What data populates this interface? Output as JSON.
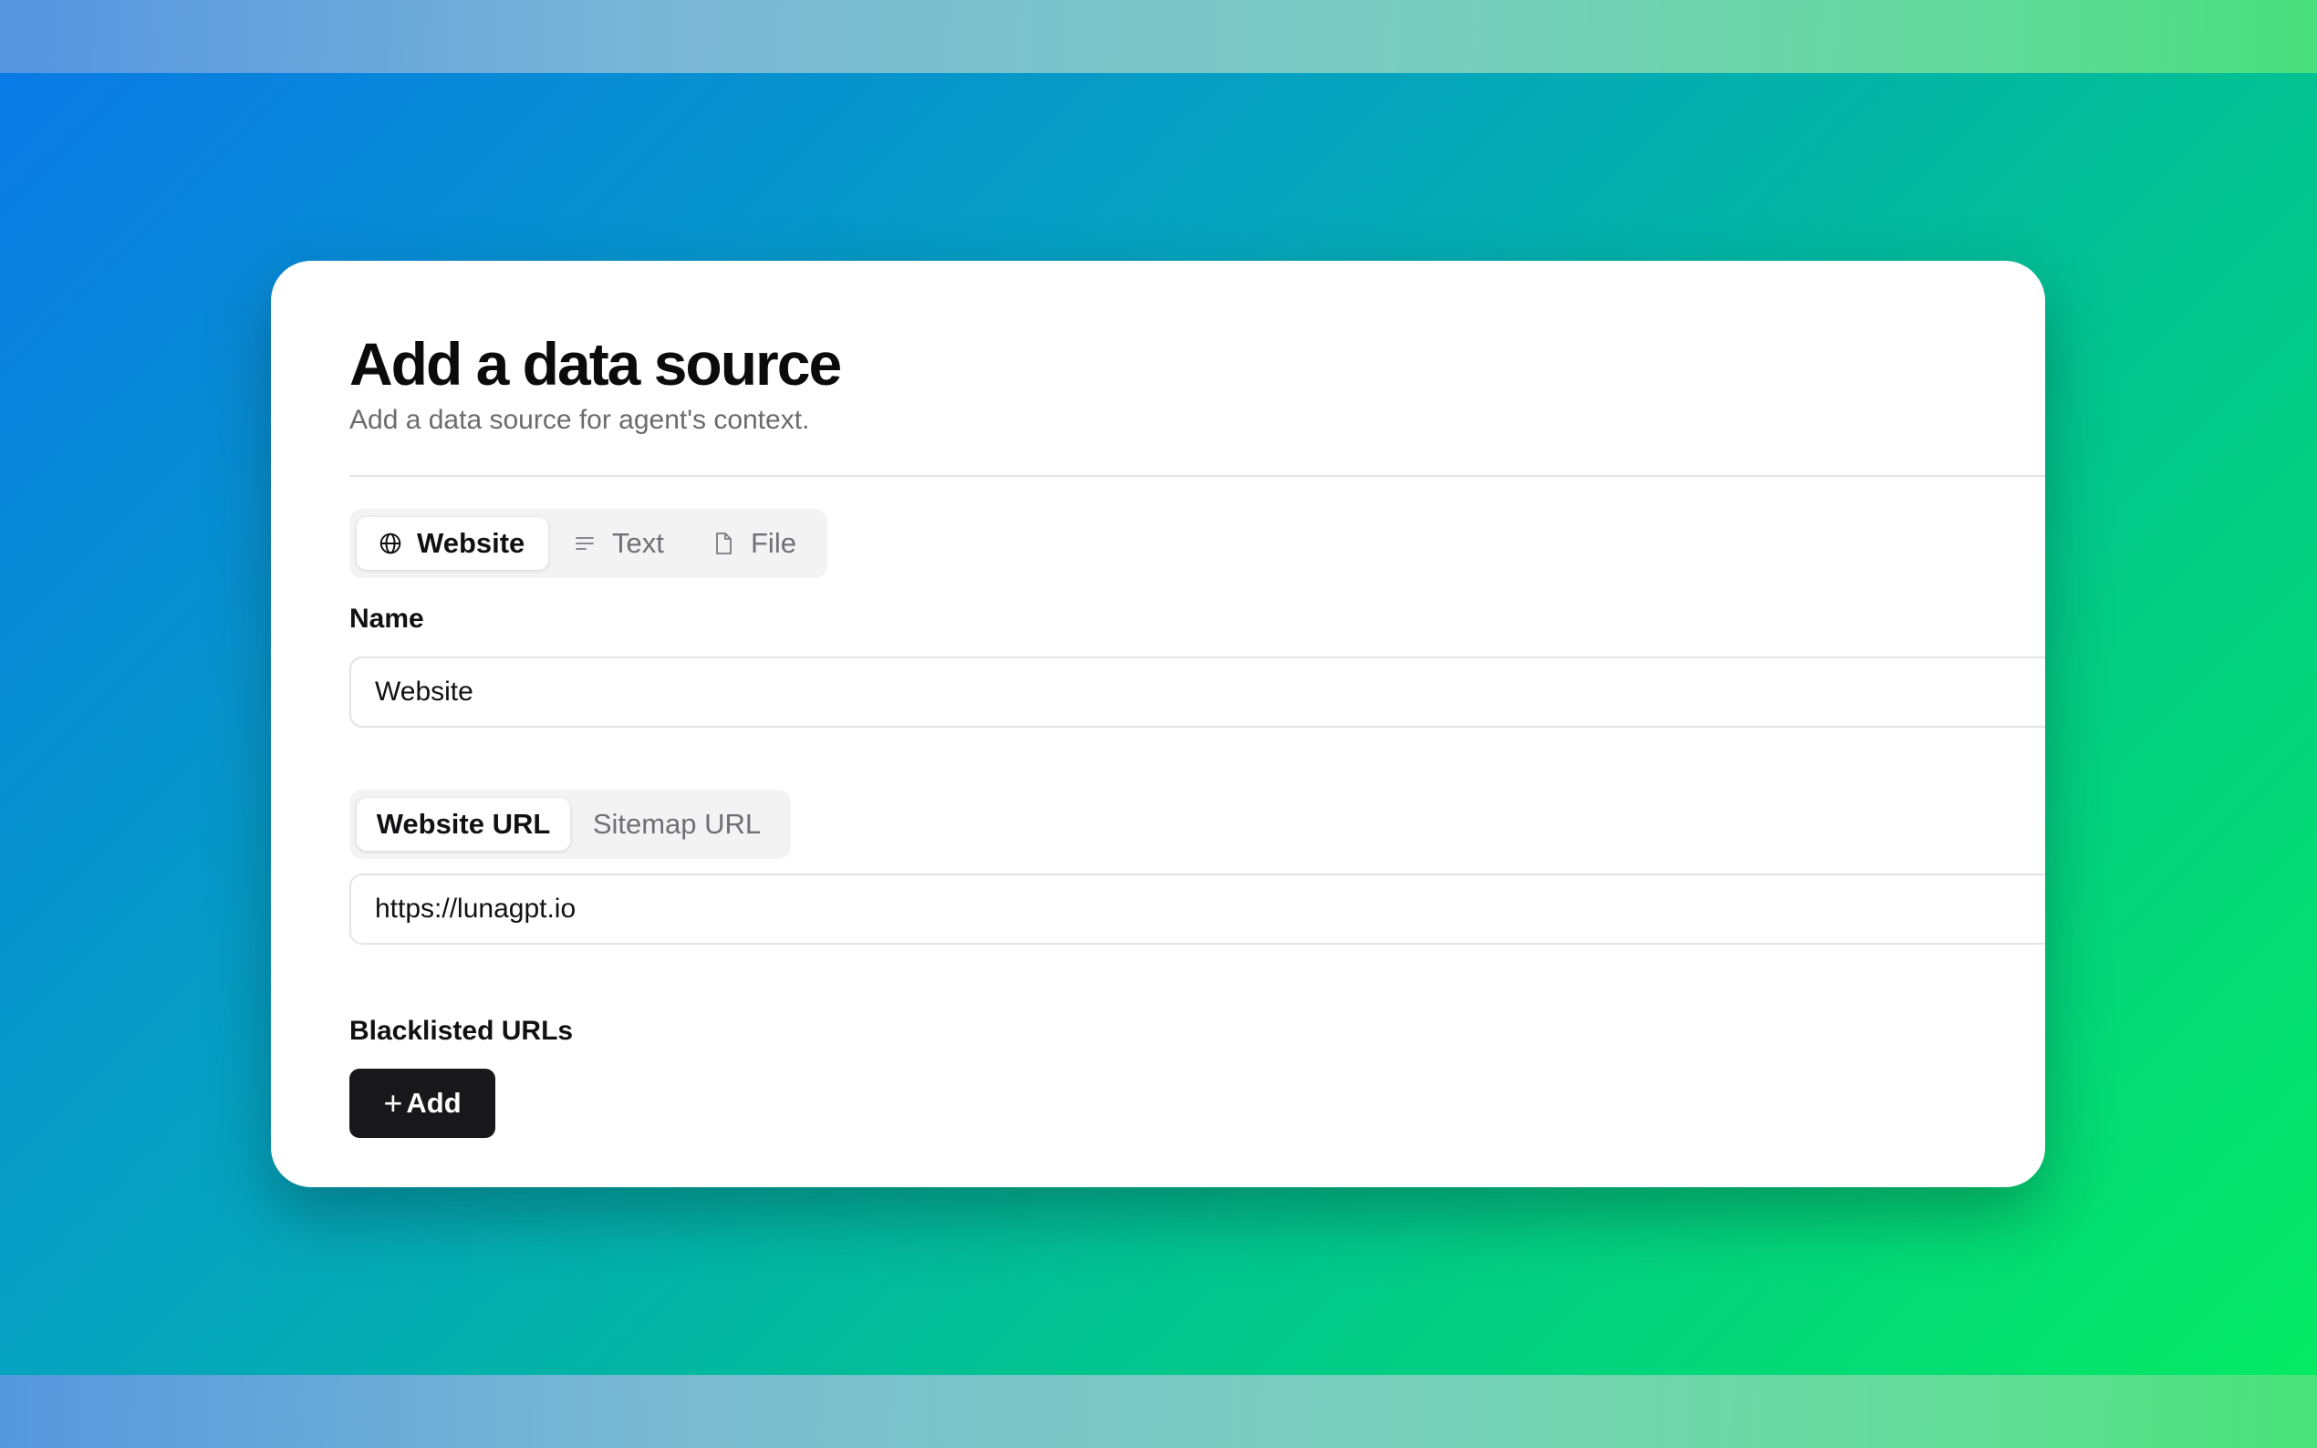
{
  "page": {
    "title": "Add a data source",
    "subtitle": "Add a data source for agent's context."
  },
  "source_tabs": [
    {
      "label": "Website",
      "icon": "globe-icon",
      "active": true
    },
    {
      "label": "Text",
      "icon": "text-lines-icon",
      "active": false
    },
    {
      "label": "File",
      "icon": "file-icon",
      "active": false
    }
  ],
  "name_field": {
    "label": "Name",
    "value": "Website"
  },
  "url_tabs": [
    {
      "label": "Website URL",
      "active": true
    },
    {
      "label": "Sitemap URL",
      "active": false
    }
  ],
  "url_field": {
    "value": "https://lunagpt.io"
  },
  "blacklist": {
    "label": "Blacklisted URLs",
    "add_icon": "+",
    "add_label": "Add"
  },
  "colors": {
    "background_gradient": [
      "#0a78e8",
      "#05a3bf",
      "#02c48f",
      "#05ec62"
    ],
    "card": "#ffffff",
    "primary_button": "#18181a",
    "text_primary": "#0b0b0c",
    "text_muted": "#6b6b70"
  }
}
